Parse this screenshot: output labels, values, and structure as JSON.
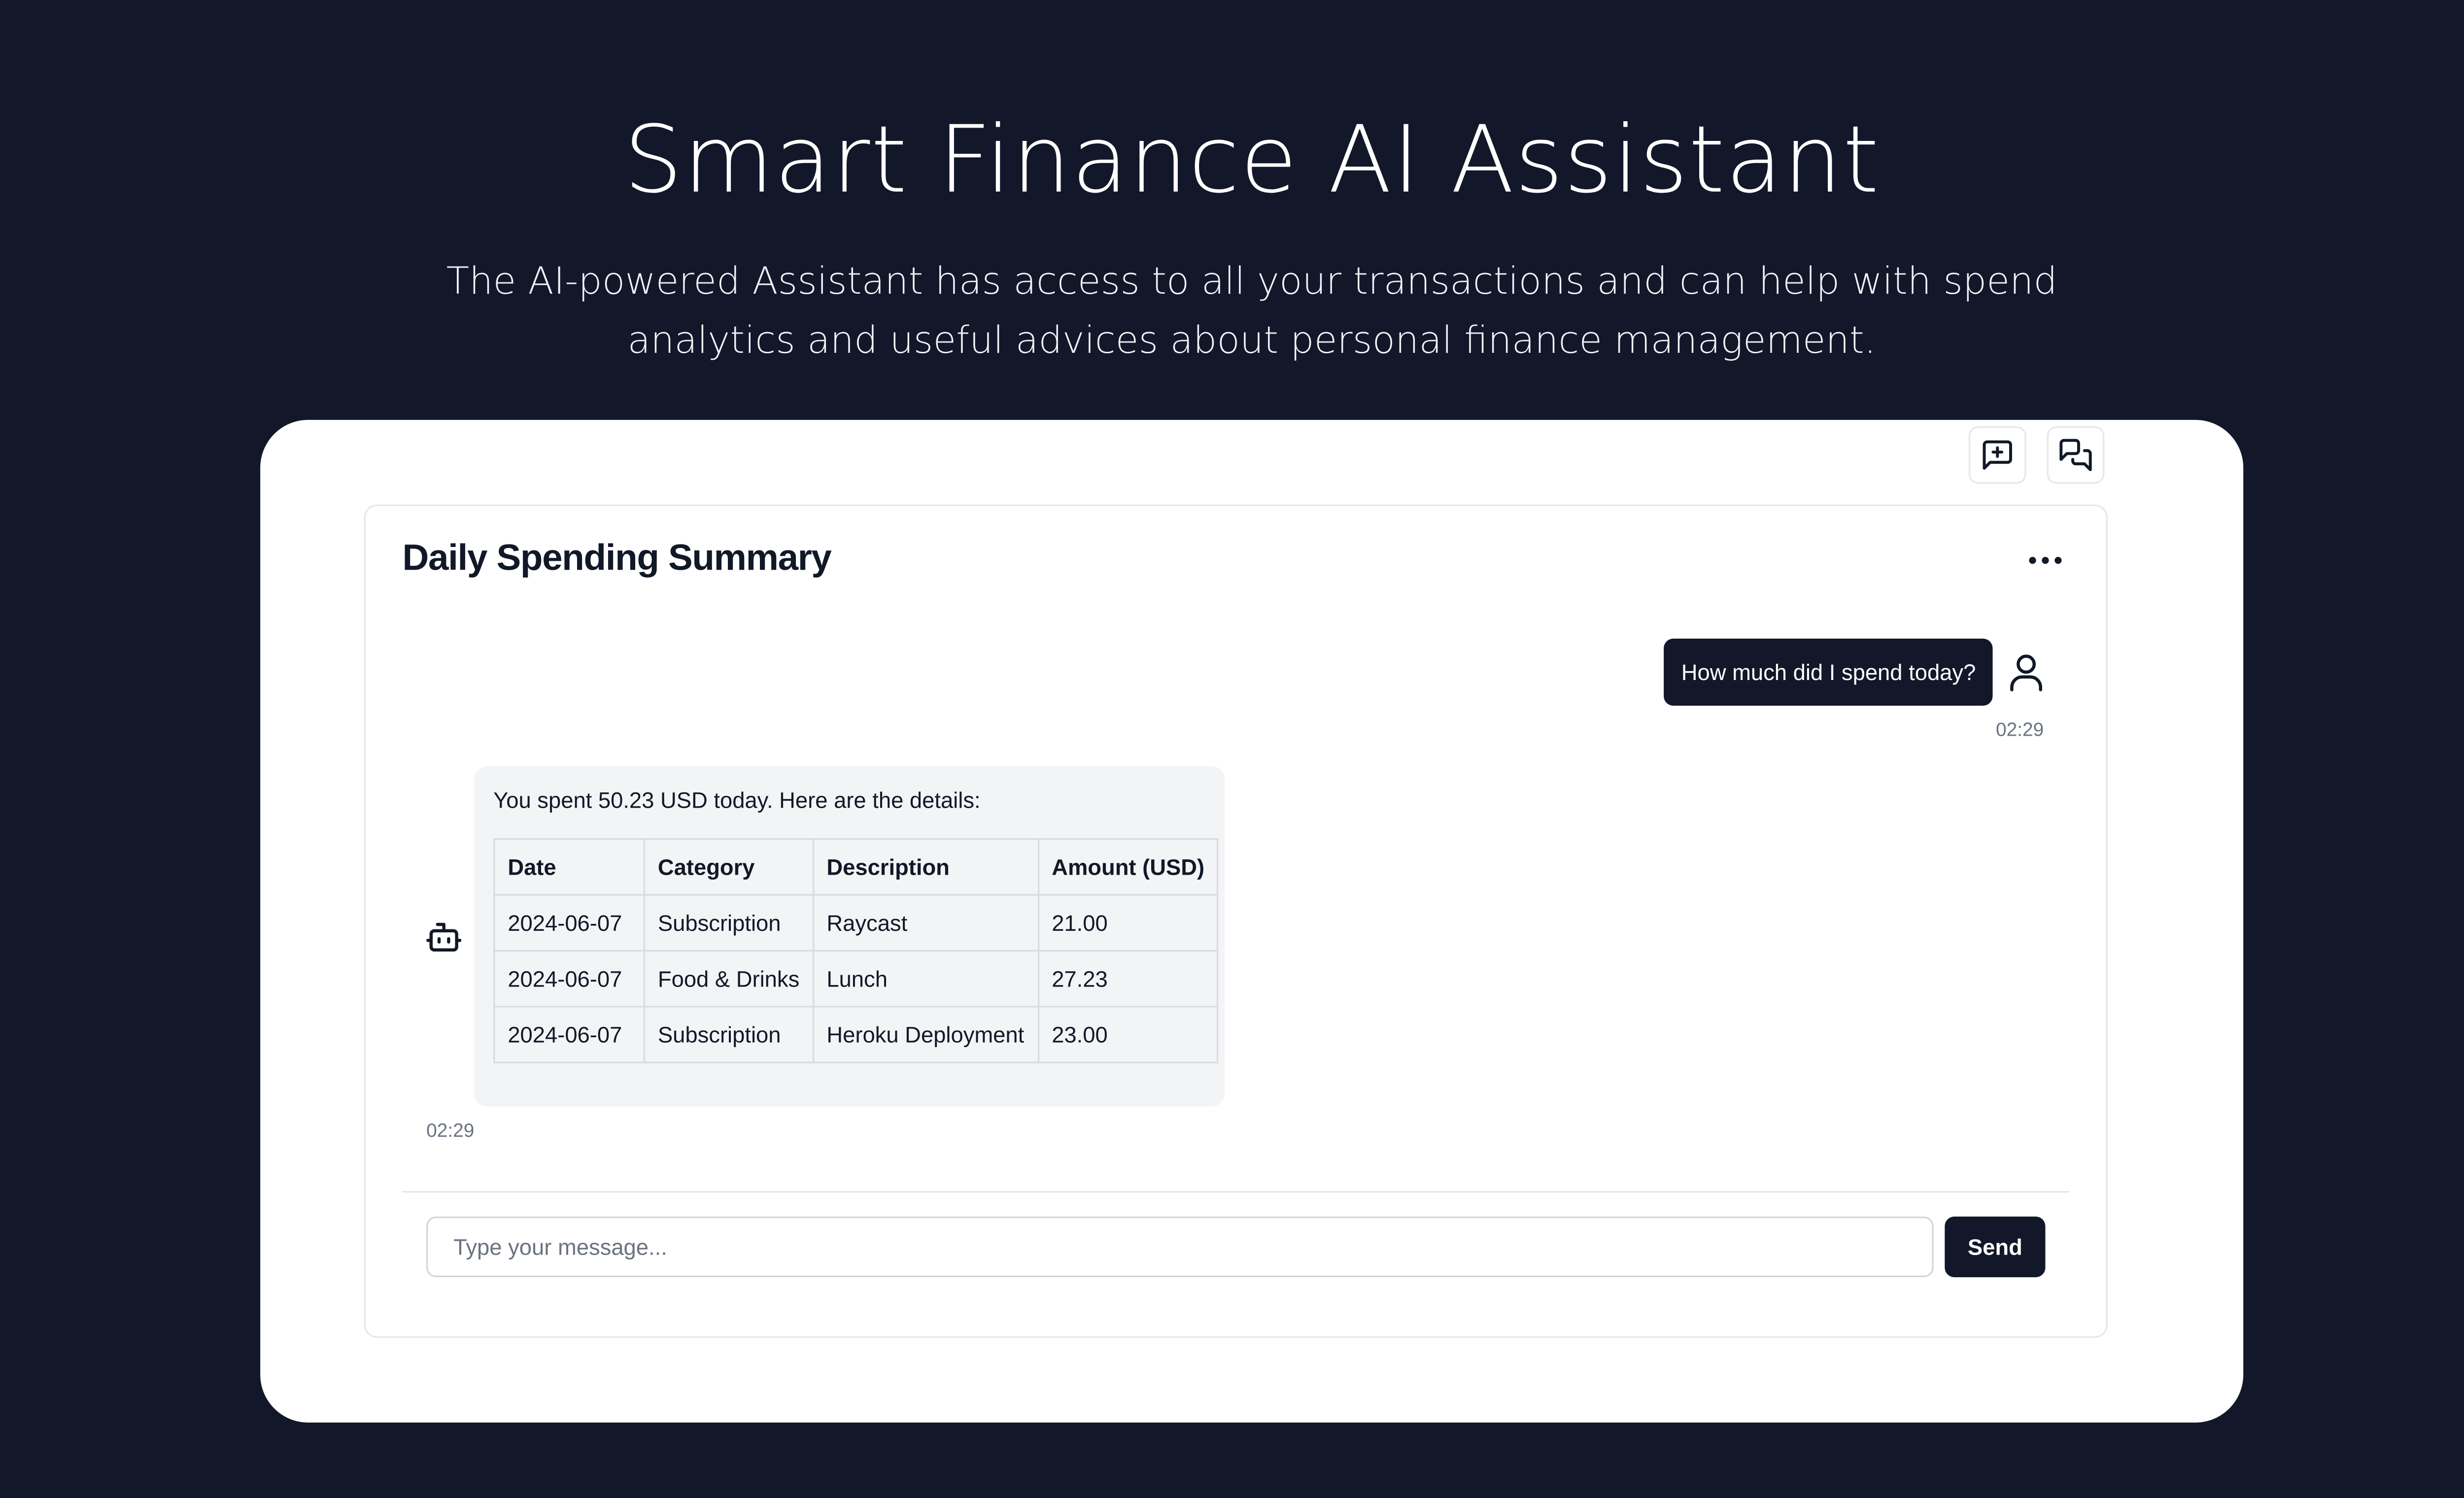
{
  "hero": {
    "title": "Smart Finance AI Assistant",
    "subtitle": "The AI-powered Assistant has access to all your transactions and can help with spend analytics and useful advices about personal finance management."
  },
  "toolbar": {
    "new_chat_icon": "message-square-plus-icon",
    "chat_history_icon": "messages-icon"
  },
  "chat": {
    "title": "Daily Spending Summary",
    "menu_icon": "more-horizontal-icon",
    "messages": [
      {
        "role": "user",
        "text": "How much did I spend today?",
        "time": "02:29",
        "avatar_icon": "user-icon"
      },
      {
        "role": "assistant",
        "text": "You spent 50.23 USD today. Here are the details:",
        "time": "02:29",
        "avatar_icon": "bot-icon",
        "table": {
          "headers": [
            "Date",
            "Category",
            "Description",
            "Amount (USD)"
          ],
          "rows": [
            [
              "2024-06-07",
              "Subscription",
              "Raycast",
              "21.00"
            ],
            [
              "2024-06-07",
              "Food & Drinks",
              "Lunch",
              "27.23"
            ],
            [
              "2024-06-07",
              "Subscription",
              "Heroku Deployment",
              "23.00"
            ]
          ]
        }
      }
    ]
  },
  "composer": {
    "placeholder": "Type your message...",
    "value": "",
    "send_label": "Send"
  },
  "colors": {
    "background": "#121729",
    "card": "#ffffff",
    "accent": "#121729",
    "assistant_bubble": "#f3f4f6",
    "border": "#e5e7eb"
  }
}
